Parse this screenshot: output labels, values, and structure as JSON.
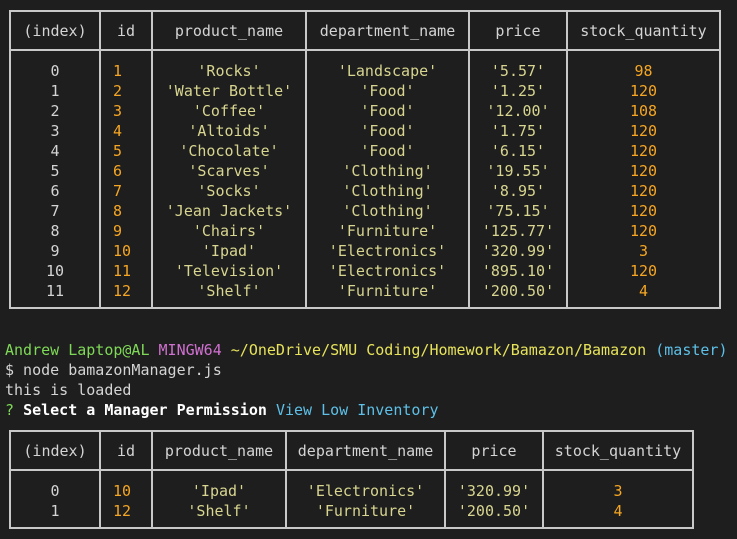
{
  "table1": {
    "headers": [
      "(index)",
      "id",
      "product_name",
      "department_name",
      "price",
      "stock_quantity"
    ],
    "rows": [
      [
        "0",
        "1",
        "'Rocks'",
        "'Landscape'",
        "'5.57'",
        "98"
      ],
      [
        "1",
        "2",
        "'Water Bottle'",
        "'Food'",
        "'1.25'",
        "120"
      ],
      [
        "2",
        "3",
        "'Coffee'",
        "'Food'",
        "'12.00'",
        "108"
      ],
      [
        "3",
        "4",
        "'Altoids'",
        "'Food'",
        "'1.75'",
        "120"
      ],
      [
        "4",
        "5",
        "'Chocolate'",
        "'Food'",
        "'6.15'",
        "120"
      ],
      [
        "5",
        "6",
        "'Scarves'",
        "'Clothing'",
        "'19.55'",
        "120"
      ],
      [
        "6",
        "7",
        "'Socks'",
        "'Clothing'",
        "'8.95'",
        "120"
      ],
      [
        "7",
        "8",
        "'Jean Jackets'",
        "'Clothing'",
        "'75.15'",
        "120"
      ],
      [
        "8",
        "9",
        "'Chairs'",
        "'Furniture'",
        "'125.77'",
        "120"
      ],
      [
        "9",
        "10",
        "'Ipad'",
        "'Electronics'",
        "'320.99'",
        "3"
      ],
      [
        "10",
        "11",
        "'Television'",
        "'Electronics'",
        "'895.10'",
        "120"
      ],
      [
        "11",
        "12",
        "'Shelf'",
        "'Furniture'",
        "'200.50'",
        "4"
      ]
    ]
  },
  "prompt": {
    "user_host": "Andrew Laptop@AL",
    "system": "MINGW64",
    "path": "~/OneDrive/SMU Coding/Homework/Bamazon/Bamazon",
    "branch": "(master)"
  },
  "command": "$ node bamazonManager.js",
  "output_line": "this is loaded",
  "question": {
    "mark": "?",
    "text": "Select a Manager Permission",
    "answer": "View Low Inventory"
  },
  "table2": {
    "headers": [
      "(index)",
      "id",
      "product_name",
      "department_name",
      "price",
      "stock_quantity"
    ],
    "rows": [
      [
        "0",
        "10",
        "'Ipad'",
        "'Electronics'",
        "'320.99'",
        "3"
      ],
      [
        "1",
        "12",
        "'Shelf'",
        "'Furniture'",
        "'200.50'",
        "4"
      ]
    ]
  },
  "colors": {
    "background": "#1e1e1e",
    "orange_numbers": "#f5a623",
    "string_values": "#d7d58f",
    "prompt_user": "#7ed957",
    "prompt_system": "#d070d0",
    "prompt_path": "#e7e35a",
    "prompt_branch": "#5dc0e8"
  }
}
